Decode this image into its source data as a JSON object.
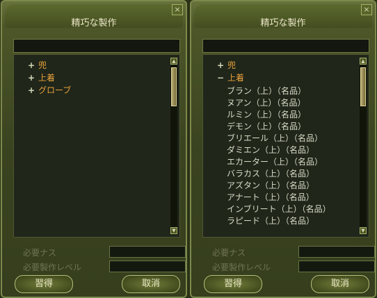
{
  "left": {
    "title": "精巧な製作",
    "close": "×",
    "tree": [
      {
        "label": "兜",
        "icon": "+"
      },
      {
        "label": "上着",
        "icon": "+"
      },
      {
        "label": "グローブ",
        "icon": "+"
      }
    ],
    "fields": {
      "cost_label": "必要ナス",
      "level_label": "必要製作レベル"
    },
    "buttons": {
      "learn": "習得",
      "cancel": "取消"
    }
  },
  "right": {
    "title": "精巧な製作",
    "close": "×",
    "categories": [
      {
        "label": "兜",
        "icon": "+"
      },
      {
        "label": "上着",
        "icon": "−"
      }
    ],
    "items": [
      "ブラン（上）（名品）",
      "ヌアン（上）（名品）",
      "ルミン（上）（名品）",
      "デモン（上）（名品）",
      "ブリエール（上）（名品）",
      "ダミエン（上）（名品）",
      "エカーター（上）（名品）",
      "バラカス（上）（名品）",
      "アズタン（上）（名品）",
      "アナート（上）（名品）",
      "インブリート（上）（名品）",
      "ラピード（上）（名品）"
    ],
    "fields": {
      "cost_label": "必要ナス",
      "level_label": "必要製作レベル"
    },
    "buttons": {
      "learn": "習得",
      "cancel": "取消"
    }
  },
  "colors": {
    "category": "#e8a23c",
    "item": "#dadcc8",
    "label_dim": "#6f7354"
  },
  "icons": {
    "expand": "plus-icon",
    "collapse": "minus-icon",
    "close": "close-icon",
    "scroll_up": "arrow-up-icon",
    "scroll_down": "arrow-down-icon"
  },
  "scrollbar": {
    "up_glyph": "▲",
    "down_glyph": "▼"
  }
}
